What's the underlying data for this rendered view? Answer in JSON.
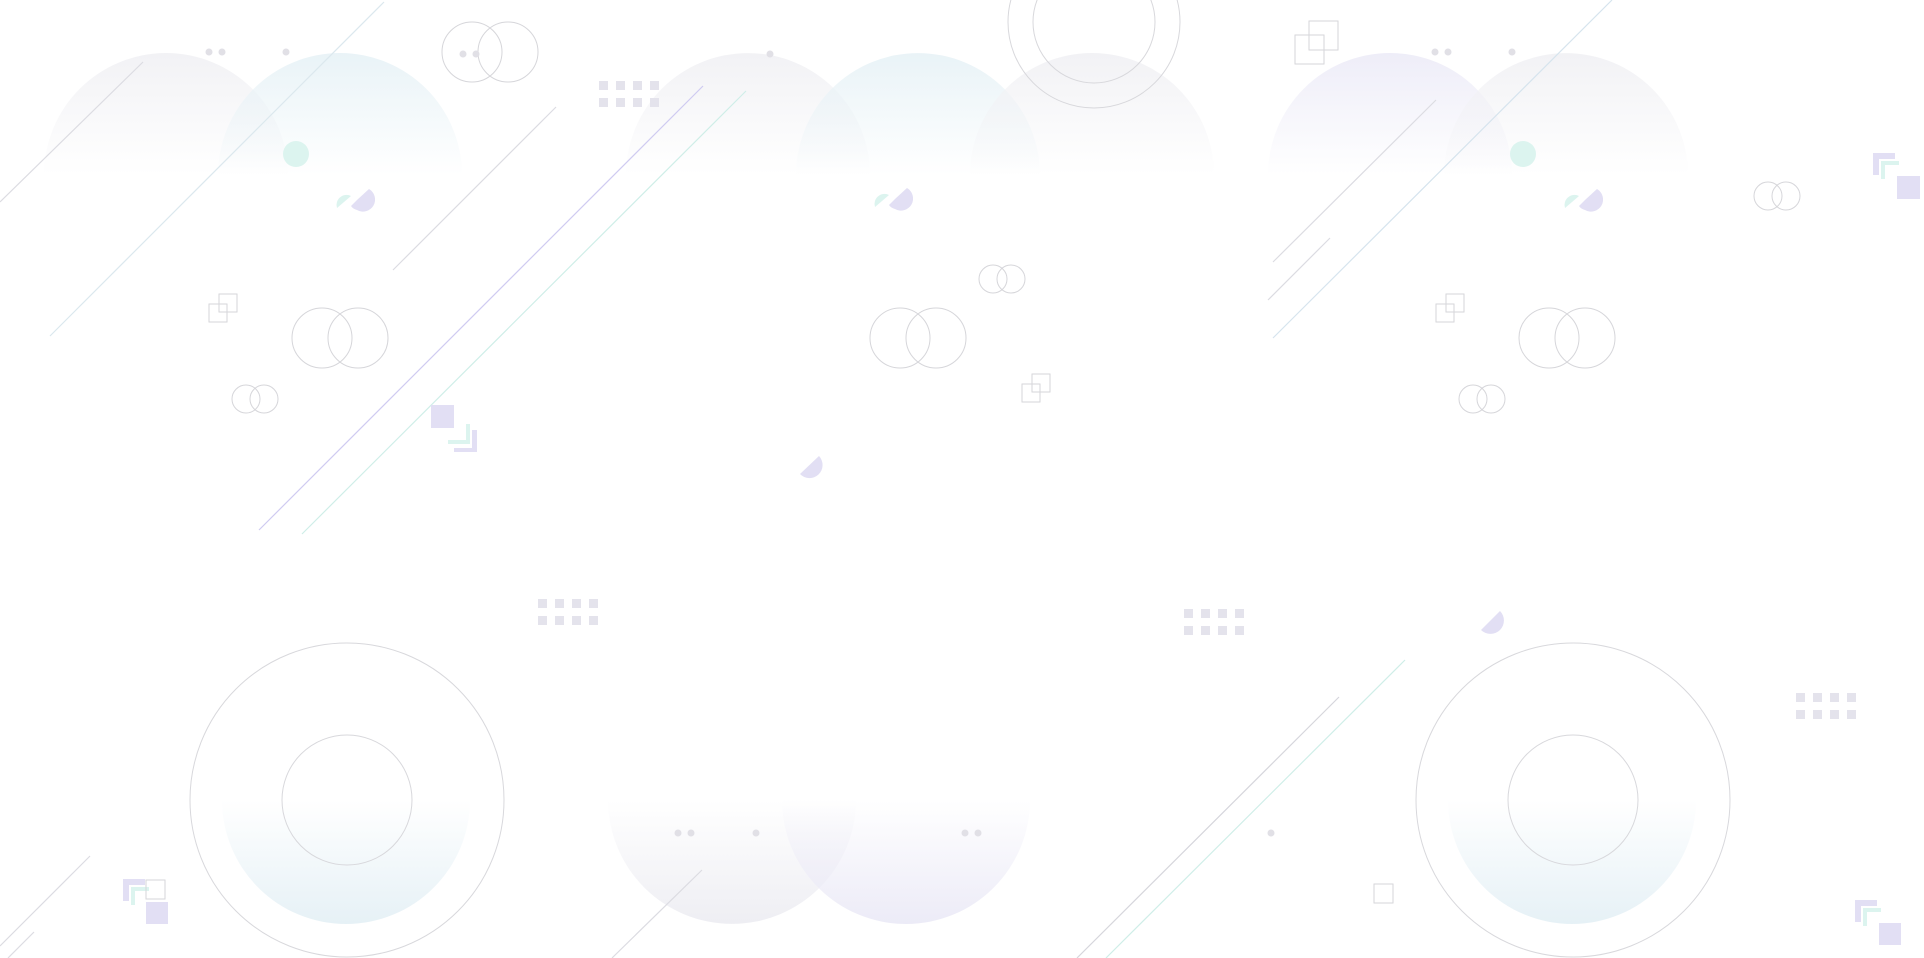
{
  "canvas": {
    "background": "#ffffff"
  },
  "palette": {
    "line_gray": "#d8d8dc",
    "line_lavender": "#c9c6ee",
    "line_mint": "#c8ece6",
    "fill_lavender": "#e2dff4",
    "fill_mint": "#dcf4ef",
    "fill_dots": "#e4e3ea",
    "dome_gray": "#f3f3f6",
    "dome_blue": "#eaf3f7",
    "dome_lavender": "#efeef8"
  },
  "motifs": [
    "gradient-dome",
    "diagonal-line",
    "outlined-circle-pair",
    "concentric-ring",
    "half-disc",
    "square-grid",
    "stacked-squares",
    "dot-cluster"
  ]
}
